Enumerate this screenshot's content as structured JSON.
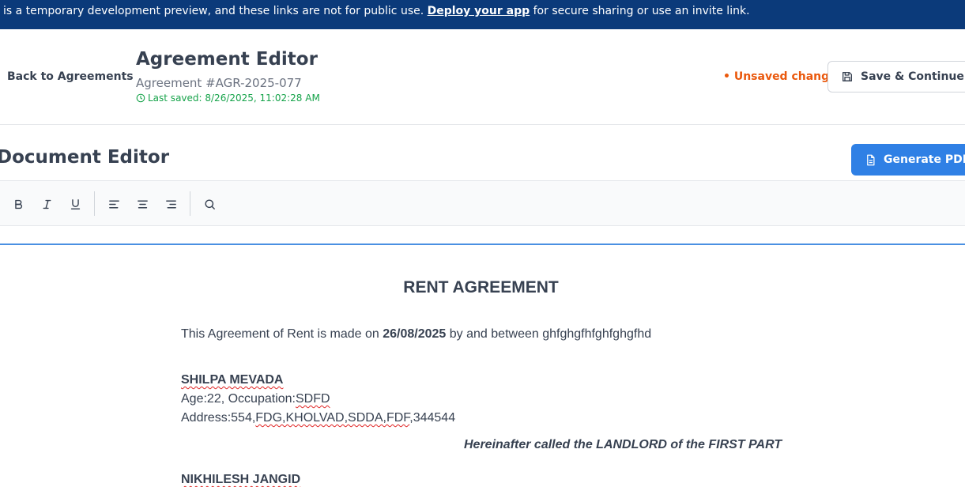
{
  "banner": {
    "text_before": "is a temporary development preview, and these links are not for public use.",
    "link": "Deploy your app",
    "text_after": "for secure sharing or use an invite link."
  },
  "header": {
    "back_label": "Back to Agreements",
    "title": "Agreement Editor",
    "agreement_number": "Agreement #AGR-2025-077",
    "last_saved": "Last saved: 8/26/2025, 11:02:28 AM",
    "unsaved": "• Unsaved changes",
    "save_label": "Save & Continue Later"
  },
  "editor": {
    "title": "Document Editor",
    "generate_pdf_label": "Generate PDF"
  },
  "toolbar": {
    "icons": [
      "bold-icon",
      "italic-icon",
      "underline-icon",
      "align-left-icon",
      "align-center-icon",
      "align-right-icon",
      "search-icon"
    ]
  },
  "document": {
    "heading": "RENT AGREEMENT",
    "intro_before": "This Agreement of Rent is made on",
    "intro_date": "26/08/2025",
    "intro_after": "by and between ghfghgfhfghfghgfhd",
    "landlord_name": "SHILPA MEVADA",
    "landlord_age": "Age:22, Occupation:",
    "landlord_occupation": "SDFD",
    "landlord_address_prefix": "Address:554,",
    "landlord_address_rest": "FDG,KHOLVAD,SDDA,FDF",
    "landlord_address_pin": ",344544",
    "landlord_role": "Hereinafter called the LANDLORD of the FIRST PART",
    "tenant_name": "NIKHILESH JANGID"
  },
  "colors": {
    "banner": "#0b3a7a",
    "primary": "#2f80e5",
    "unsaved": "#ea580c",
    "saved": "#16a34a"
  }
}
